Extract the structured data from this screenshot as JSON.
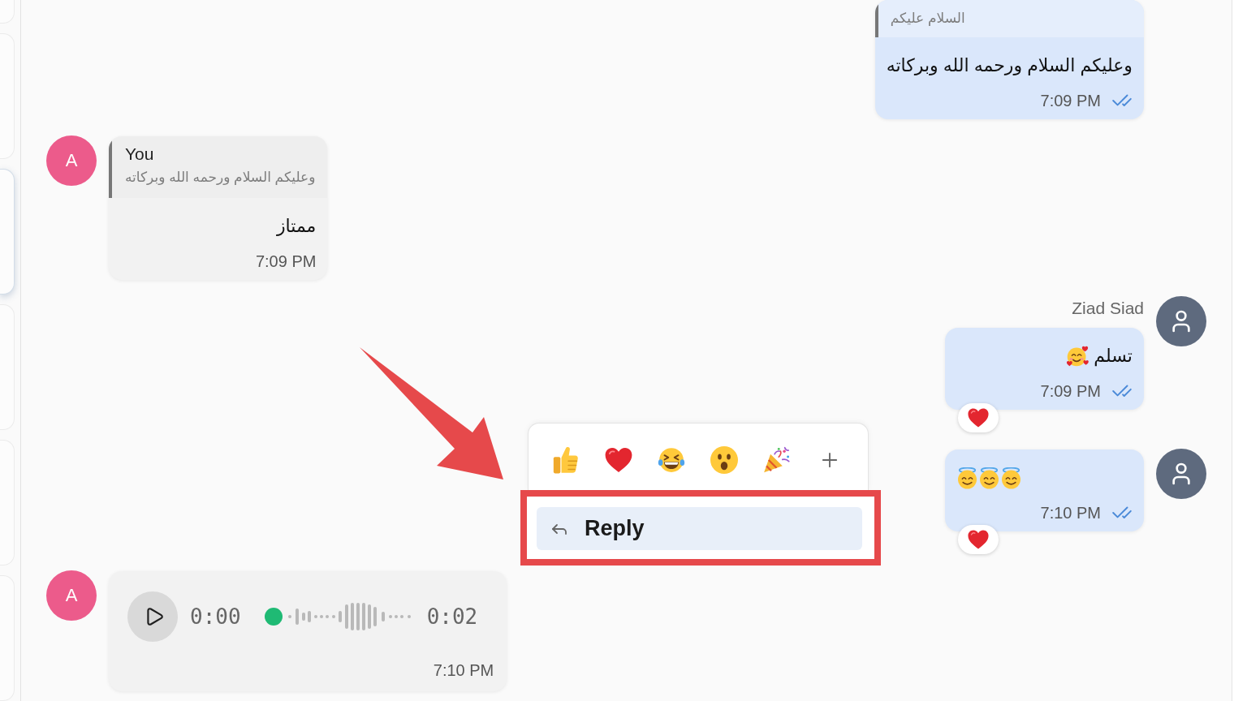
{
  "sidebar": {
    "cards": [
      {
        "selected": false
      },
      {
        "selected": false
      },
      {
        "selected": true
      },
      {
        "selected": false
      },
      {
        "selected": false
      },
      {
        "selected": false
      }
    ]
  },
  "messages": [
    {
      "kind": "text",
      "outgoing": true,
      "quote": {
        "text": "السلام عليكم"
      },
      "text": "وعليكم السلام ورحمه الله وبركاته",
      "time": "7:09 PM",
      "read": true
    },
    {
      "kind": "text",
      "outgoing": false,
      "avatar": {
        "kind": "initial",
        "initial": "A",
        "color": "#ec5b8b"
      },
      "quote": {
        "author": "You",
        "text": "وعليكم السلام ورحمه الله وبركاته"
      },
      "text": "ممتاز",
      "time": "7:09 PM"
    },
    {
      "kind": "text",
      "outgoing": true,
      "sender": "Ziad Siad",
      "avatar": {
        "kind": "user",
        "color": "#5e6a7e"
      },
      "text": "تسلم",
      "emojis": [
        {
          "kind": "hearts"
        }
      ],
      "time": "7:09 PM",
      "read": true,
      "reaction": {
        "kind": "heart"
      }
    },
    {
      "kind": "emoji",
      "outgoing": true,
      "avatar": {
        "kind": "user",
        "color": "#5e6a7e"
      },
      "emojis": [
        {
          "kind": "halo"
        },
        {
          "kind": "halo"
        },
        {
          "kind": "halo"
        }
      ],
      "time": "7:10 PM",
      "read": true,
      "reaction": {
        "kind": "heart"
      }
    },
    {
      "kind": "audio",
      "outgoing": false,
      "avatar": {
        "kind": "initial",
        "initial": "A",
        "color": "#ec5b8b"
      },
      "elapsed": "0:00",
      "duration": "0:02",
      "level": 0,
      "time": "7:10 PM"
    }
  ],
  "reaction_picker": {
    "reactions": [
      {
        "kind": "thumbsup"
      },
      {
        "kind": "heart"
      },
      {
        "kind": "laughing"
      },
      {
        "kind": "surprised"
      },
      {
        "kind": "party"
      },
      {
        "kind": "add"
      }
    ],
    "menu": [
      {
        "kind": "reply",
        "label": "Reply",
        "active": true,
        "highlighted": true
      }
    ]
  }
}
